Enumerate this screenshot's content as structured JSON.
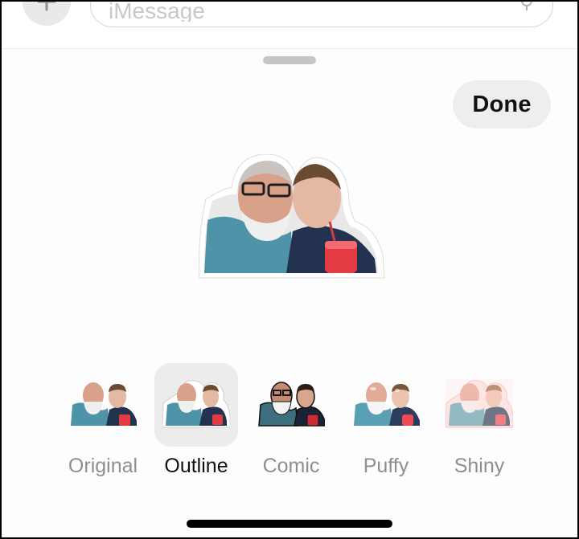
{
  "compose": {
    "placeholder": "iMessage",
    "plus_icon": "plus-icon",
    "mic_icon": "microphone-icon"
  },
  "sheet": {
    "done_label": "Done"
  },
  "sticker": {
    "subject": "sticker-photo",
    "selected_effect": "Outline"
  },
  "effects": [
    {
      "label": "Original"
    },
    {
      "label": "Outline"
    },
    {
      "label": "Comic"
    },
    {
      "label": "Puffy"
    },
    {
      "label": "Shiny"
    }
  ],
  "colors": {
    "background": "#fdfdfd",
    "selected_tile": "#ececed",
    "label_inactive": "#8e8e93",
    "label_active": "#111111",
    "button_bg": "#eeeeef"
  }
}
